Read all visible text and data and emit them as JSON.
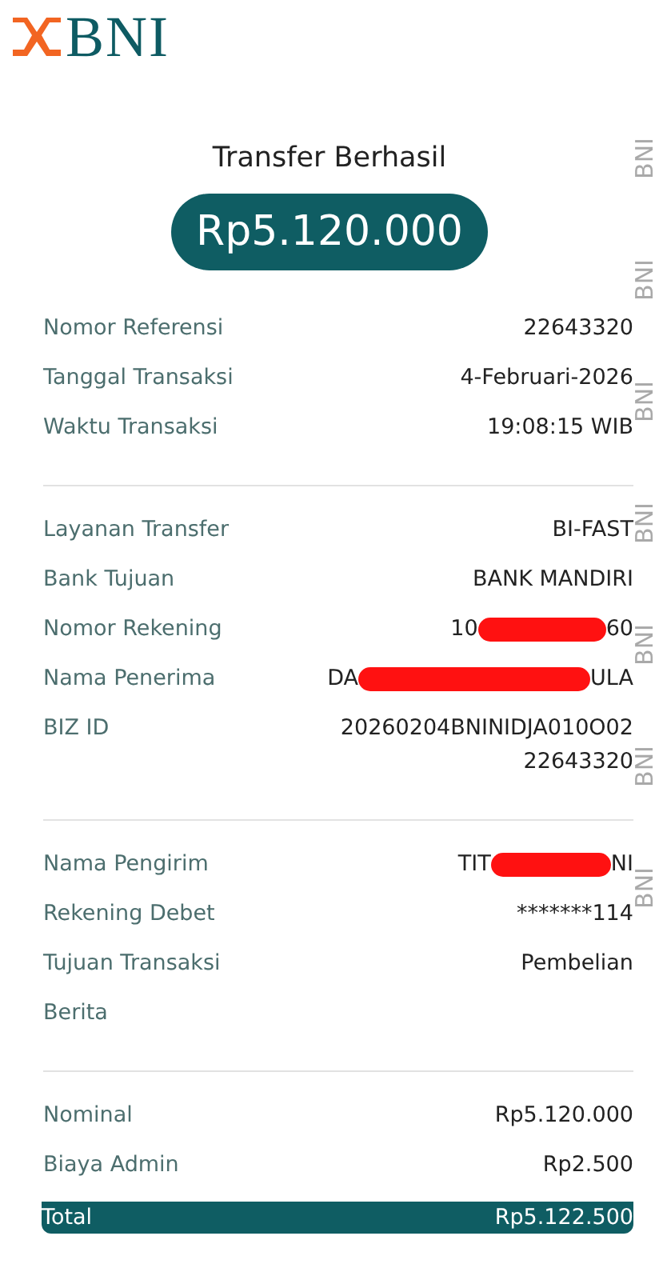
{
  "logo": {
    "text": "BNI"
  },
  "title": "Transfer Berhasil",
  "amount": "Rp5.120.000",
  "sections": [
    {
      "rows": [
        {
          "kind": "plain",
          "label": "Nomor Referensi",
          "value": "22643320"
        },
        {
          "kind": "plain",
          "label": "Tanggal Transaksi",
          "value": "4-Februari-2026"
        },
        {
          "kind": "plain",
          "label": "Waktu Transaksi",
          "value": "19:08:15 WIB"
        }
      ]
    },
    {
      "rows": [
        {
          "kind": "plain",
          "label": "Layanan Transfer",
          "value": "BI-FAST"
        },
        {
          "kind": "plain",
          "label": "Bank Tujuan",
          "value": "BANK MANDIRI"
        },
        {
          "kind": "redacted",
          "label": "Nomor Rekening",
          "value_start": "10",
          "value_end": "60"
        },
        {
          "kind": "redacted",
          "label": "Nama Penerima",
          "value_start": "DA",
          "value_end": "ULA"
        },
        {
          "kind": "wrapped",
          "label": "BIZ ID",
          "value_lines": [
            "20260204BNINIDJA010O02",
            "22643320"
          ]
        }
      ]
    },
    {
      "rows": [
        {
          "kind": "redacted",
          "label": "Nama Pengirim",
          "value_start": "TIT",
          "value_end": "NI"
        },
        {
          "kind": "plain",
          "label": "Rekening Debet",
          "value": "*******114"
        },
        {
          "kind": "plain",
          "label": "Tujuan Transaksi",
          "value": "Pembelian"
        },
        {
          "kind": "plain",
          "label": "Berita"
        }
      ]
    },
    {
      "rows": [
        {
          "kind": "plain",
          "label": "Nominal",
          "value": "Rp5.120.000"
        },
        {
          "kind": "plain",
          "label": "Biaya Admin",
          "value": "Rp2.500"
        }
      ]
    }
  ],
  "total": {
    "label": "Total",
    "value": "Rp5.122.500"
  },
  "security_strip": [
    "BNI",
    "BNI",
    "BNI",
    "BNI",
    "BNI",
    "BNI",
    "BNI"
  ]
}
